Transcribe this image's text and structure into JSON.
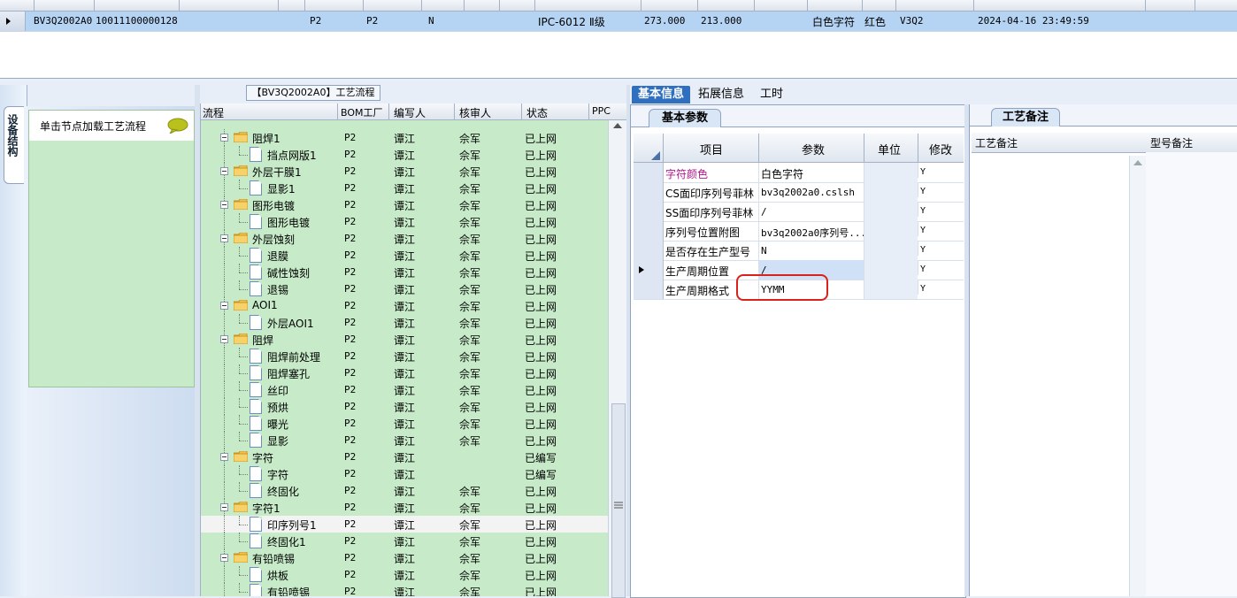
{
  "top_grid": {
    "row": {
      "model": "BV3Q2002A0",
      "code": "10011100000128",
      "factory": "P2",
      "bom_factory": "P2",
      "flag": "N",
      "grade": "IPC-6012 Ⅱ级",
      "thickness": "273.000",
      "width": "213.000",
      "char_type": "白色字符",
      "color": "红色",
      "version": "V3Q2",
      "created": "2024-04-16 23:49:59"
    }
  },
  "left_panel": {
    "side_tab": "设备结构",
    "hint": "单击节点加载工艺流程"
  },
  "process": {
    "title": "【BV3Q2002A0】工艺流程",
    "columns": [
      "流程",
      "BOM工厂",
      "编写人",
      "核审人",
      "状态",
      "PPC"
    ],
    "rows": [
      {
        "name": "阻焊1",
        "level": 0,
        "bom": "P2",
        "writer": "谭江",
        "reviewer": "佘军",
        "status": "已上网"
      },
      {
        "name": "挡点网版1",
        "level": 1,
        "bom": "P2",
        "writer": "谭江",
        "reviewer": "佘军",
        "status": "已上网"
      },
      {
        "name": "外层干膜1",
        "level": 0,
        "bom": "P2",
        "writer": "谭江",
        "reviewer": "佘军",
        "status": "已上网"
      },
      {
        "name": "显影1",
        "level": 1,
        "bom": "P2",
        "writer": "谭江",
        "reviewer": "佘军",
        "status": "已上网"
      },
      {
        "name": "图形电镀",
        "level": 0,
        "bom": "P2",
        "writer": "谭江",
        "reviewer": "佘军",
        "status": "已上网"
      },
      {
        "name": "图形电镀",
        "level": 1,
        "bom": "P2",
        "writer": "谭江",
        "reviewer": "佘军",
        "status": "已上网"
      },
      {
        "name": "外层蚀刻",
        "level": 0,
        "bom": "P2",
        "writer": "谭江",
        "reviewer": "佘军",
        "status": "已上网"
      },
      {
        "name": "退膜",
        "level": 1,
        "bom": "P2",
        "writer": "谭江",
        "reviewer": "佘军",
        "status": "已上网"
      },
      {
        "name": "碱性蚀刻",
        "level": 1,
        "bom": "P2",
        "writer": "谭江",
        "reviewer": "佘军",
        "status": "已上网"
      },
      {
        "name": "退锡",
        "level": 1,
        "bom": "P2",
        "writer": "谭江",
        "reviewer": "佘军",
        "status": "已上网"
      },
      {
        "name": "AOI1",
        "level": 0,
        "bom": "P2",
        "writer": "谭江",
        "reviewer": "佘军",
        "status": "已上网"
      },
      {
        "name": "外层AOI1",
        "level": 1,
        "bom": "P2",
        "writer": "谭江",
        "reviewer": "佘军",
        "status": "已上网"
      },
      {
        "name": "阻焊",
        "level": 0,
        "bom": "P2",
        "writer": "谭江",
        "reviewer": "佘军",
        "status": "已上网"
      },
      {
        "name": "阻焊前处理",
        "level": 1,
        "bom": "P2",
        "writer": "谭江",
        "reviewer": "佘军",
        "status": "已上网"
      },
      {
        "name": "阻焊塞孔",
        "level": 1,
        "bom": "P2",
        "writer": "谭江",
        "reviewer": "佘军",
        "status": "已上网"
      },
      {
        "name": "丝印",
        "level": 1,
        "bom": "P2",
        "writer": "谭江",
        "reviewer": "佘军",
        "status": "已上网"
      },
      {
        "name": "预烘",
        "level": 1,
        "bom": "P2",
        "writer": "谭江",
        "reviewer": "佘军",
        "status": "已上网"
      },
      {
        "name": "曝光",
        "level": 1,
        "bom": "P2",
        "writer": "谭江",
        "reviewer": "佘军",
        "status": "已上网"
      },
      {
        "name": "显影",
        "level": 1,
        "bom": "P2",
        "writer": "谭江",
        "reviewer": "佘军",
        "status": "已上网"
      },
      {
        "name": "字符",
        "level": 0,
        "bom": "P2",
        "writer": "谭江",
        "reviewer": "",
        "status": "已编写"
      },
      {
        "name": "字符",
        "level": 1,
        "bom": "P2",
        "writer": "谭江",
        "reviewer": "",
        "status": "已编写"
      },
      {
        "name": "终固化",
        "level": 1,
        "bom": "P2",
        "writer": "谭江",
        "reviewer": "佘军",
        "status": "已上网"
      },
      {
        "name": "字符1",
        "level": 0,
        "bom": "P2",
        "writer": "谭江",
        "reviewer": "佘军",
        "status": "已上网"
      },
      {
        "name": "印序列号1",
        "level": 1,
        "bom": "P2",
        "writer": "谭江",
        "reviewer": "佘军",
        "status": "已上网",
        "selected": true
      },
      {
        "name": "终固化1",
        "level": 1,
        "bom": "P2",
        "writer": "谭江",
        "reviewer": "佘军",
        "status": "已上网"
      },
      {
        "name": "有铅喷锡",
        "level": 0,
        "bom": "P2",
        "writer": "谭江",
        "reviewer": "佘军",
        "status": "已上网"
      },
      {
        "name": "烘板",
        "level": 1,
        "bom": "P2",
        "writer": "谭江",
        "reviewer": "佘军",
        "status": "已上网"
      },
      {
        "name": "有铅喷锡",
        "level": 1,
        "bom": "P2",
        "writer": "谭江",
        "reviewer": "佘军",
        "status": "已上网"
      }
    ]
  },
  "tabs": [
    "基本信息",
    "拓展信息",
    "工时"
  ],
  "basic": {
    "tab": "基本参数",
    "columns": [
      "项目",
      "参数",
      "单位",
      "修改"
    ],
    "rows": [
      {
        "item": "字符颜色",
        "value": "白色字符",
        "unit": "",
        "modify": "Y",
        "highlight": true
      },
      {
        "item": "CS面印序列号菲林",
        "value": "bv3q2002a0.cslsh",
        "unit": "",
        "modify": "Y"
      },
      {
        "item": "SS面印序列号菲林",
        "value": "/",
        "unit": "",
        "modify": "Y"
      },
      {
        "item": "序列号位置附图",
        "value": "bv3q2002a0序列号...",
        "unit": "",
        "modify": "Y"
      },
      {
        "item": "是否存在生产型号",
        "value": "N",
        "unit": "",
        "modify": "Y"
      },
      {
        "item": "生产周期位置",
        "value": "/",
        "unit": "",
        "modify": "Y",
        "current": true
      },
      {
        "item": "生产周期格式",
        "value": "YYMM",
        "unit": "",
        "modify": "Y"
      }
    ]
  },
  "remark": {
    "tab": "工艺备注",
    "columns": [
      "工艺备注",
      "型号备注"
    ]
  },
  "colors": {
    "highlight_text": "#b0178a",
    "annotation": "#d8221a",
    "tree_bg": "#c7ebc9",
    "tab_active": "#2f6fc0"
  }
}
